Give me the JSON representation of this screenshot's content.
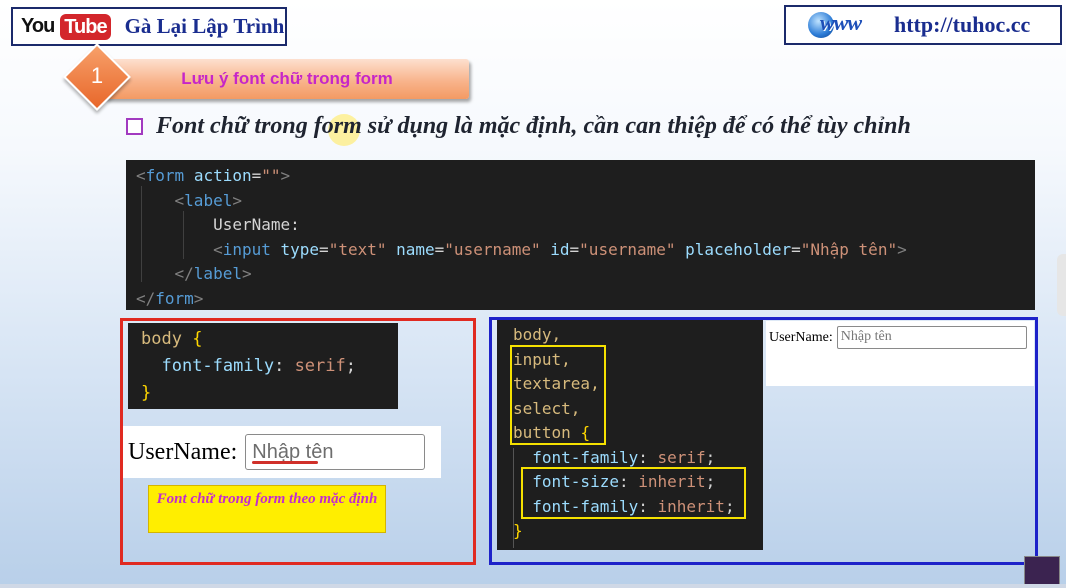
{
  "header": {
    "youtube_you": "You",
    "youtube_tube": "Tube",
    "channel_name": "Gà Lại Lập Trình",
    "www_logo": "www",
    "site_url": "http://tuhoc.cc"
  },
  "step": {
    "number": "1",
    "title": "Lưu ý font chữ trong form"
  },
  "heading": "Font chữ trong form sử dụng là mặc định, cần can thiệp để có thể tùy chỉnh",
  "html_code": {
    "line1_open": "<",
    "line1_tag": "form",
    "line1_attr": "action",
    "line1_eq": "=",
    "line1_val": "\"\"",
    "line1_close": ">",
    "line2_open": "<",
    "line2_tag": "label",
    "line2_close": ">",
    "line3_text": "UserName:",
    "line4_open": "<",
    "line4_tag": "input",
    "attr_type": "type",
    "val_type": "\"text\"",
    "attr_name": "name",
    "val_name": "\"username\"",
    "attr_id": "id",
    "val_id": "\"username\"",
    "attr_placeholder": "placeholder",
    "val_placeholder": "\"Nhập tên\"",
    "line4_close": ">",
    "line5_open": "</",
    "line5_tag": "label",
    "line5_close": ">",
    "line6_open": "</",
    "line6_tag": "form",
    "line6_close": ">"
  },
  "css_serif": {
    "selector": "body",
    "open_brace": "{",
    "property": "font-family",
    "value": "serif",
    "close_brace": "}"
  },
  "demo_default": {
    "label": "UserName:",
    "placeholder": "Nhập tên"
  },
  "note": "Font chữ trong form theo mặc định",
  "css_inherit": {
    "sel_body": "body,",
    "sel_input": "input,",
    "sel_textarea": "textarea,",
    "sel_select": "select,",
    "sel_button": "button",
    "open_brace": "{",
    "prop1": "font-family",
    "val1": "serif",
    "prop2": "font-size",
    "val2": "inherit",
    "prop3": "font-family",
    "val3": "inherit",
    "close_brace": "}"
  },
  "demo_inherit": {
    "label": "UserName:",
    "placeholder": "Nhập tên"
  },
  "colors": {
    "panel_red": "#e02a21",
    "panel_blue": "#1d22c9",
    "highlight_yellow": "#f5e100",
    "title_magenta": "#c626c8"
  }
}
